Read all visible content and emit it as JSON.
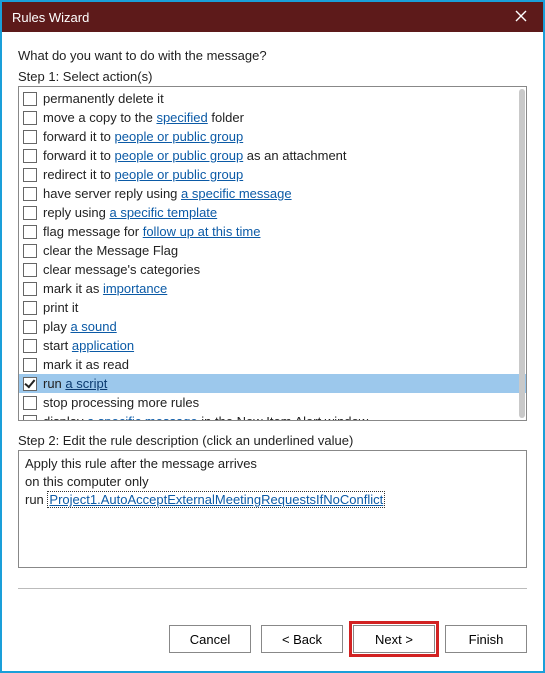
{
  "window": {
    "title": "Rules Wizard"
  },
  "prompt": "What do you want to do with the message?",
  "step1_label": "Step 1: Select action(s)",
  "actions": [
    {
      "checked": false,
      "selected": false,
      "parts": [
        {
          "t": "permanently delete it"
        }
      ]
    },
    {
      "checked": false,
      "selected": false,
      "parts": [
        {
          "t": "move a copy to the "
        },
        {
          "t": "specified",
          "link": true
        },
        {
          "t": " folder"
        }
      ]
    },
    {
      "checked": false,
      "selected": false,
      "parts": [
        {
          "t": "forward it to "
        },
        {
          "t": "people or public group",
          "link": true
        }
      ]
    },
    {
      "checked": false,
      "selected": false,
      "parts": [
        {
          "t": "forward it to "
        },
        {
          "t": "people or public group",
          "link": true
        },
        {
          "t": " as an attachment"
        }
      ]
    },
    {
      "checked": false,
      "selected": false,
      "parts": [
        {
          "t": "redirect it to "
        },
        {
          "t": "people or public group",
          "link": true
        }
      ]
    },
    {
      "checked": false,
      "selected": false,
      "parts": [
        {
          "t": "have server reply using "
        },
        {
          "t": "a specific message",
          "link": true
        }
      ]
    },
    {
      "checked": false,
      "selected": false,
      "parts": [
        {
          "t": "reply using "
        },
        {
          "t": "a specific template",
          "link": true
        }
      ]
    },
    {
      "checked": false,
      "selected": false,
      "parts": [
        {
          "t": "flag message for "
        },
        {
          "t": "follow up at this time",
          "link": true
        }
      ]
    },
    {
      "checked": false,
      "selected": false,
      "parts": [
        {
          "t": "clear the Message Flag"
        }
      ]
    },
    {
      "checked": false,
      "selected": false,
      "parts": [
        {
          "t": "clear message's categories"
        }
      ]
    },
    {
      "checked": false,
      "selected": false,
      "parts": [
        {
          "t": "mark it as "
        },
        {
          "t": "importance",
          "link": true
        }
      ]
    },
    {
      "checked": false,
      "selected": false,
      "parts": [
        {
          "t": "print it"
        }
      ]
    },
    {
      "checked": false,
      "selected": false,
      "parts": [
        {
          "t": "play "
        },
        {
          "t": "a sound",
          "link": true
        }
      ]
    },
    {
      "checked": false,
      "selected": false,
      "parts": [
        {
          "t": "start "
        },
        {
          "t": "application",
          "link": true
        }
      ]
    },
    {
      "checked": false,
      "selected": false,
      "parts": [
        {
          "t": "mark it as read"
        }
      ]
    },
    {
      "checked": true,
      "selected": true,
      "parts": [
        {
          "t": "run "
        },
        {
          "t": "a script",
          "link": true
        }
      ]
    },
    {
      "checked": false,
      "selected": false,
      "parts": [
        {
          "t": "stop processing more rules"
        }
      ]
    },
    {
      "checked": false,
      "selected": false,
      "parts": [
        {
          "t": "display "
        },
        {
          "t": "a specific message",
          "link": true
        },
        {
          "t": " in the New Item Alert window"
        }
      ]
    }
  ],
  "step2_label": "Step 2: Edit the rule description (click an underlined value)",
  "description": {
    "line1": "Apply this rule after the message arrives",
    "line2": "on this computer only",
    "line3_prefix": "run ",
    "line3_script": "Project1.AutoAcceptExternalMeetingRequestsIfNoConflict"
  },
  "buttons": {
    "cancel": "Cancel",
    "back": "< Back",
    "next": "Next >",
    "finish": "Finish"
  }
}
